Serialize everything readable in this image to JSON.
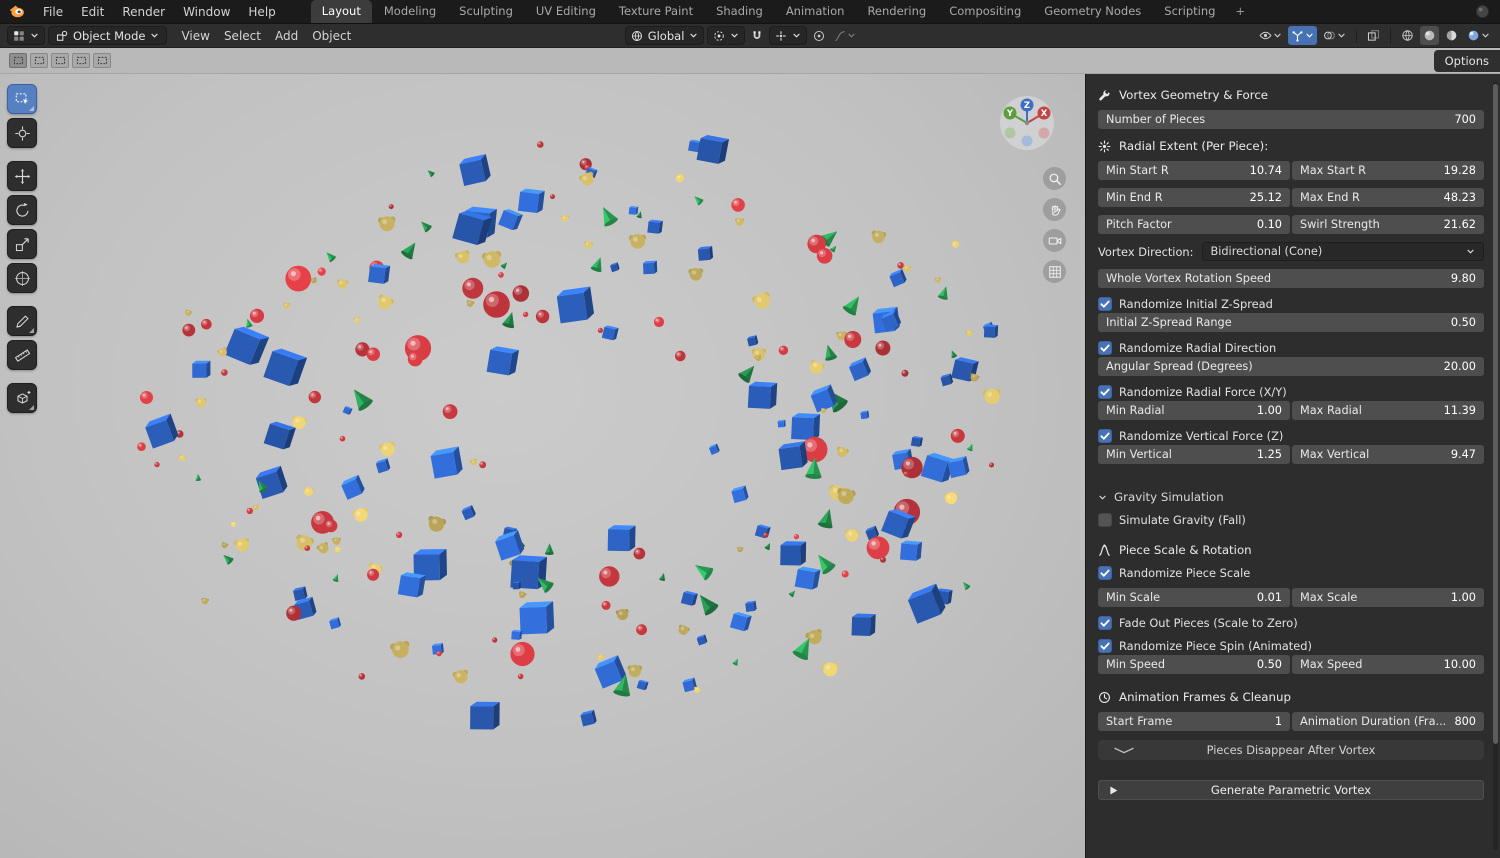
{
  "topbar": {
    "menus": [
      "File",
      "Edit",
      "Render",
      "Window",
      "Help"
    ],
    "workspaces": [
      "Layout",
      "Modeling",
      "Sculpting",
      "UV Editing",
      "Texture Paint",
      "Shading",
      "Animation",
      "Rendering",
      "Compositing",
      "Geometry Nodes",
      "Scripting"
    ],
    "active_workspace": "Layout",
    "add_workspace_label": "+"
  },
  "toolbar": {
    "mode": "Object Mode",
    "menus": [
      "View",
      "Select",
      "Add",
      "Object"
    ],
    "center_tools": [
      {
        "name": "transform-orientation",
        "icon": "globe",
        "label": "Global",
        "chevron": true,
        "pill": true
      },
      {
        "name": "transform-pivot",
        "icon": "pivot",
        "chevron": true,
        "pill": true
      },
      {
        "name": "snap-toggle",
        "icon": "magnet"
      },
      {
        "name": "snap-settings",
        "icon": "snapto",
        "chevron": true,
        "pill": true
      },
      {
        "name": "proportional-toggle",
        "icon": "prop"
      },
      {
        "name": "proportional-settings",
        "icon": "falloff",
        "chevron": true,
        "dim": true
      }
    ],
    "right_tools": [
      {
        "name": "object-visibility",
        "icon": "eye",
        "chevron": true
      },
      {
        "name": "show-gizmos",
        "icon": "gizmo",
        "chevron": true,
        "active": true
      },
      {
        "name": "show-overlays",
        "icon": "overlays",
        "chevron": true
      },
      {
        "name": "toggle-xray",
        "icon": "xray"
      },
      {
        "name": "shading-wireframe",
        "icon": "sphere-wire"
      },
      {
        "name": "shading-solid",
        "icon": "sphere-solid",
        "selected": true
      },
      {
        "name": "shading-material",
        "icon": "sphere-material"
      },
      {
        "name": "shading-rendered",
        "icon": "sphere-rendered",
        "chevron": true
      }
    ],
    "options_label": "Options"
  },
  "tool_settings": {
    "select_modes": [
      "new",
      "extend",
      "subtract",
      "invert",
      "intersect"
    ],
    "active_mode": "new"
  },
  "tool_shelf": {
    "items": [
      "select-box",
      "cursor",
      "move",
      "rotate",
      "scale",
      "transform",
      "annotate",
      "measure",
      "add-primitive"
    ],
    "active": "select-box",
    "group_breaks": [
      1,
      5,
      7
    ]
  },
  "viewport": {
    "nav_buttons": [
      "zoom",
      "pan",
      "camera-view",
      "toggle-orthographic"
    ],
    "gizmo_axes": {
      "x": "X",
      "y": "Y",
      "z": "Z"
    },
    "object_colors": {
      "sphere": "#c8383f",
      "cube": "#2d63c4",
      "cone": "#2fa95c",
      "blob": "#d6bf68"
    }
  },
  "sidebar": {
    "rows": [
      {
        "type": "section",
        "icon": "wrench",
        "label": "Vortex Geometry & Force"
      },
      {
        "type": "slider",
        "label": "Number of Pieces",
        "value": "700"
      },
      {
        "type": "section",
        "icon": "force",
        "label": "Radial Extent (Per Piece):"
      },
      {
        "type": "pair",
        "left": {
          "label": "Min Start R",
          "value": "10.74"
        },
        "right": {
          "label": "Max Start R",
          "value": "19.28"
        }
      },
      {
        "type": "pair",
        "left": {
          "label": "Min End R",
          "value": "25.12"
        },
        "right": {
          "label": "Max End R",
          "value": "48.23"
        }
      },
      {
        "type": "pair",
        "left": {
          "label": "Pitch Factor",
          "value": "0.10"
        },
        "right": {
          "label": "Swirl Strength",
          "value": "21.62"
        }
      },
      {
        "type": "dropdown",
        "label": "Vortex Direction:",
        "value": "Bidirectional (Cone)"
      },
      {
        "type": "slider",
        "label": "Whole Vortex Rotation Speed",
        "value": "9.80"
      },
      {
        "type": "checkbox",
        "label": "Randomize Initial Z-Spread",
        "checked": true
      },
      {
        "type": "slider",
        "label": "Initial Z-Spread Range",
        "value": "0.50",
        "tight": true
      },
      {
        "type": "checkbox",
        "label": "Randomize Radial Direction",
        "checked": true
      },
      {
        "type": "slider",
        "label": "Angular Spread (Degrees)",
        "value": "20.00",
        "tight": true
      },
      {
        "type": "checkbox",
        "label": "Randomize Radial Force (X/Y)",
        "checked": true
      },
      {
        "type": "pair",
        "tight": true,
        "left": {
          "label": "Min Radial",
          "value": "1.00"
        },
        "right": {
          "label": "Max Radial",
          "value": "11.39"
        }
      },
      {
        "type": "checkbox",
        "label": "Randomize Vertical Force (Z)",
        "checked": true
      },
      {
        "type": "pair",
        "tight": true,
        "left": {
          "label": "Min Vertical",
          "value": "1.25"
        },
        "right": {
          "label": "Max Vertical",
          "value": "9.47"
        }
      },
      {
        "type": "collapse-header",
        "label": "Gravity Simulation",
        "biggap": true
      },
      {
        "type": "checkbox",
        "label": "Simulate Gravity (Fall)",
        "checked": false
      },
      {
        "type": "section",
        "icon": "fcurve",
        "label": "Piece Scale & Rotation",
        "gap2": true
      },
      {
        "type": "checkbox",
        "label": "Randomize Piece Scale",
        "checked": true
      },
      {
        "type": "pair",
        "left": {
          "label": "Min Scale",
          "value": "0.01"
        },
        "right": {
          "label": "Max Scale",
          "value": "1.00"
        }
      },
      {
        "type": "checkbox",
        "label": "Fade Out Pieces (Scale to Zero)",
        "checked": true
      },
      {
        "type": "checkbox",
        "label": "Randomize Piece Spin (Animated)",
        "checked": true
      },
      {
        "type": "pair",
        "tight": true,
        "left": {
          "label": "Min Speed",
          "value": "0.50"
        },
        "right": {
          "label": "Max Speed",
          "value": "10.00"
        }
      },
      {
        "type": "section",
        "icon": "clock",
        "label": "Animation Frames & Cleanup",
        "gap2": true
      },
      {
        "type": "pair",
        "left": {
          "label": "Start Frame",
          "value": "1"
        },
        "right": {
          "label": "Animation Duration (Fra...",
          "value": "800"
        }
      },
      {
        "type": "collapsed-panel",
        "label": "Pieces Disappear After Vortex"
      },
      {
        "type": "action-button",
        "label": "Generate Parametric Vortex"
      }
    ]
  }
}
